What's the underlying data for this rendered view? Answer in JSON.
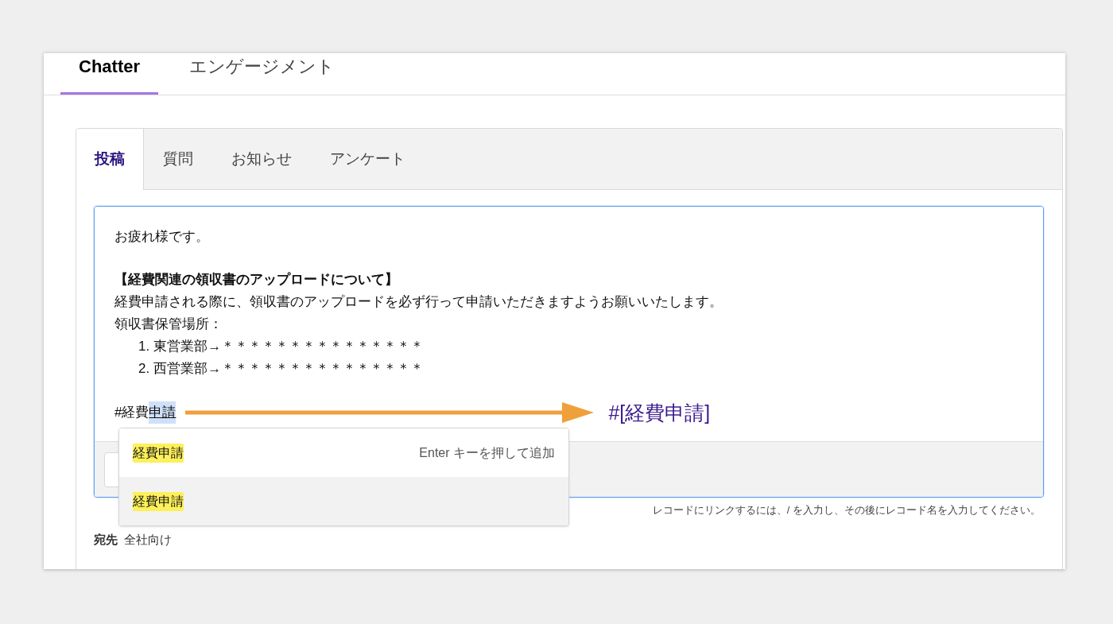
{
  "main_tabs": [
    {
      "label": "Chatter",
      "selected": true
    },
    {
      "label": "エンゲージメント",
      "selected": false
    }
  ],
  "publisher_tabs": [
    {
      "label": "投稿",
      "selected": true
    },
    {
      "label": "質問",
      "selected": false
    },
    {
      "label": "お知らせ",
      "selected": false
    },
    {
      "label": "アンケート",
      "selected": false
    }
  ],
  "editor": {
    "greeting": "お疲れ様です。",
    "heading": "【経費関連の領収書のアップロードについて】",
    "body": "経費申請される際に、領収書のアップロードを必ず行って申請いただきますようお願いいたします。",
    "list_label": "領収書保管場所：",
    "list": [
      {
        "number": "1.",
        "text": "東営業部→＊＊＊＊＊＊＊＊＊＊＊＊＊＊＊"
      },
      {
        "number": "2.",
        "text": "西営業部→＊＊＊＊＊＊＊＊＊＊＊＊＊＊＊"
      }
    ],
    "hashtag_typed": "#経費",
    "hashtag_selected": "申請"
  },
  "annotation": {
    "result": "#[経費申請]"
  },
  "suggestions": [
    {
      "match": "経費申請",
      "hint": "Enter キーを押して追加",
      "selected": false
    },
    {
      "match": "経費申請",
      "selected": true
    }
  ],
  "link_hint": "レコードにリンクするには、/ を入力し、その後にレコード名を入力してください。",
  "recipient": {
    "label": "宛先",
    "value": "全社向け"
  }
}
